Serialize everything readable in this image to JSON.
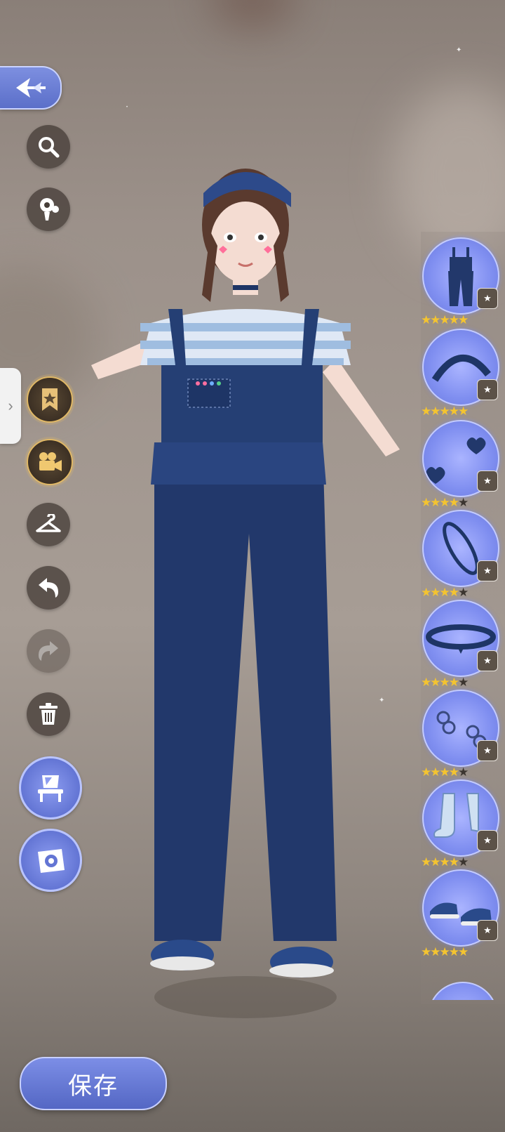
{
  "header": {
    "back_icon": "back-arrow-icon"
  },
  "toolbar": {
    "tools": [
      {
        "name": "search",
        "icon": "search-icon"
      },
      {
        "name": "filter",
        "icon": "flower-mannequin-icon"
      },
      {
        "name": "favorites",
        "icon": "bookmark-star-icon"
      },
      {
        "name": "record",
        "icon": "camera-video-icon"
      },
      {
        "name": "hanger",
        "icon": "hanger-icon"
      },
      {
        "name": "undo",
        "icon": "undo-icon"
      },
      {
        "name": "redo",
        "icon": "redo-icon"
      },
      {
        "name": "delete",
        "icon": "trash-icon"
      },
      {
        "name": "vanity",
        "icon": "vanity-mirror-icon"
      },
      {
        "name": "photo",
        "icon": "camera-icon"
      }
    ]
  },
  "outfit_items": [
    {
      "name": "denim-overalls",
      "stars": 5,
      "max_stars": 5
    },
    {
      "name": "headband",
      "stars": 5,
      "max_stars": 5
    },
    {
      "name": "heart-earrings",
      "stars": 4,
      "max_stars": 5
    },
    {
      "name": "bracelet",
      "stars": 4,
      "max_stars": 5
    },
    {
      "name": "choker",
      "stars": 4,
      "max_stars": 5
    },
    {
      "name": "chain-accessory",
      "stars": 4,
      "max_stars": 5
    },
    {
      "name": "checkered-socks",
      "stars": 4,
      "max_stars": 5
    },
    {
      "name": "sneakers",
      "stars": 5,
      "max_stars": 5
    }
  ],
  "save": {
    "label": "保存"
  },
  "colors": {
    "accent": "#6a79dc",
    "star": "#f4c430",
    "denim": "#22386b"
  }
}
